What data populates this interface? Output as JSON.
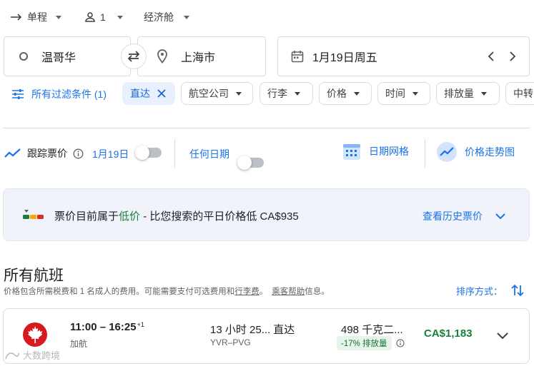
{
  "trip": {
    "type_label": "单程",
    "passengers": "1",
    "cabin": "经济舱"
  },
  "search": {
    "origin": "温哥华",
    "destination": "上海市",
    "date": "1月19日周五"
  },
  "filters": {
    "all_filters": "所有过滤条件 (1)",
    "nonstop": "直达",
    "airline": "航空公司",
    "bags": "行李",
    "price": "价格",
    "time": "时间",
    "emissions": "排放量",
    "more": "中转"
  },
  "tracking": {
    "label": "跟踪票价",
    "date_label": "1月19日",
    "any_dates": "任何日期",
    "date_grid": "日期网格",
    "price_graph": "价格走势图"
  },
  "insight": {
    "prefix": "票价目前属于",
    "level": "低价",
    "suffix": " - 比您搜索的平日价格低 CA$935",
    "history_link": "查看历史票价",
    "level_color": "#188038"
  },
  "results": {
    "title": "所有航班",
    "note_part1": "价格包含所需税费和 1 名成人的费用。可能需要支付可选费用和",
    "note_link1": "行李费",
    "note_part2": "。",
    "note_link2": "乘客帮助",
    "note_part3": "信息。",
    "sort_label": "排序方式："
  },
  "flights": [
    {
      "times": "11:00 – 16:25",
      "day_offset": "+1",
      "airline": "加航",
      "duration": "13 小时 25...",
      "stops": "直达",
      "route": "YVR–PVG",
      "emissions": "498 千克二...",
      "emissions_badge": "-17% 排放量",
      "price": "CA$1,183",
      "price_color": "#188038"
    }
  ],
  "watermark": "大数跨境",
  "colors": {
    "accent": "#1a73e8",
    "airline_brand": "#d71920"
  }
}
